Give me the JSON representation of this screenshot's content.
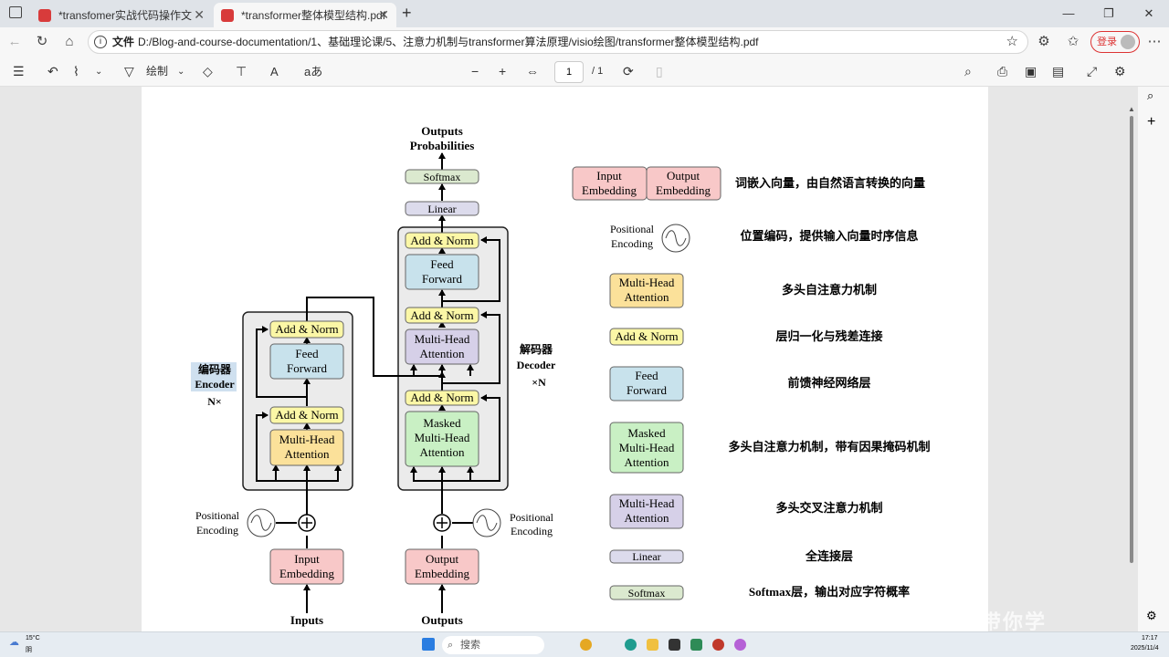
{
  "browser": {
    "tabs": [
      {
        "label": "*transfomer实战代码操作文档.pdf"
      },
      {
        "label": "*transformer整体模型结构.pdf"
      }
    ],
    "address": {
      "prefix": "文件",
      "url": "D:/Blog-and-course-documentation/1、基础理论课/5、注意力机制与transformer算法原理/visio绘图/transformer整体模型结构.pdf"
    },
    "login_label": "登录"
  },
  "toolbar": {
    "draw_label": "绘制",
    "translate_label": "aあ",
    "page_current": "1",
    "page_total": "/ 1"
  },
  "diagram": {
    "outputs_prob": [
      "Outputs",
      "Probabilities"
    ],
    "softmax": "Softmax",
    "linear": "Linear",
    "add_norm": "Add & Norm",
    "feed_forward": [
      "Feed",
      "Forward"
    ],
    "multi_head": [
      "Multi-Head",
      "Attention"
    ],
    "masked": [
      "Masked",
      "Multi-Head",
      "Attention"
    ],
    "encoder_cn": "编码器",
    "encoder_en": "Encoder",
    "encoder_n": "N×",
    "decoder_cn": "解码器",
    "decoder_en": "Decoder",
    "decoder_n": "×N",
    "positional": [
      "Positional",
      "Encoding"
    ],
    "input_emb": [
      "Input",
      "Embedding"
    ],
    "output_emb": [
      "Output",
      "Embedding"
    ],
    "inputs": "Inputs",
    "outputs": "Outputs"
  },
  "legend": [
    {
      "desc": "词嵌入向量，由自然语言转换的向量"
    },
    {
      "desc": "位置编码，提供输入向量时序信息"
    },
    {
      "desc": "多头自注意力机制"
    },
    {
      "desc": "层归一化与残差连接"
    },
    {
      "desc": "前馈神经网络层"
    },
    {
      "desc": "多头自注意力机制，带有因果掩码机制"
    },
    {
      "desc": "多头交叉注意力机制"
    },
    {
      "desc": "全连接层"
    },
    {
      "desc": "Softmax层，输出对应字符概率"
    }
  ],
  "colors": {
    "embedding": "#f8c8c8",
    "add_norm": "#fbf7a6",
    "feed_forward": "#c8e2ec",
    "multi_head": "#fbe19a",
    "masked": "#c9f0c4",
    "cross": "#d6d0e8",
    "linear": "#dcdbec",
    "softmax": "#dbe9cf",
    "block_bg": "#ebebeb"
  },
  "taskbar": {
    "weather_temp": "15°C",
    "weather_cond": "阴",
    "search_placeholder": "搜索",
    "time": "17:17",
    "date": "2025/11/4"
  },
  "watermark": "首带你学"
}
